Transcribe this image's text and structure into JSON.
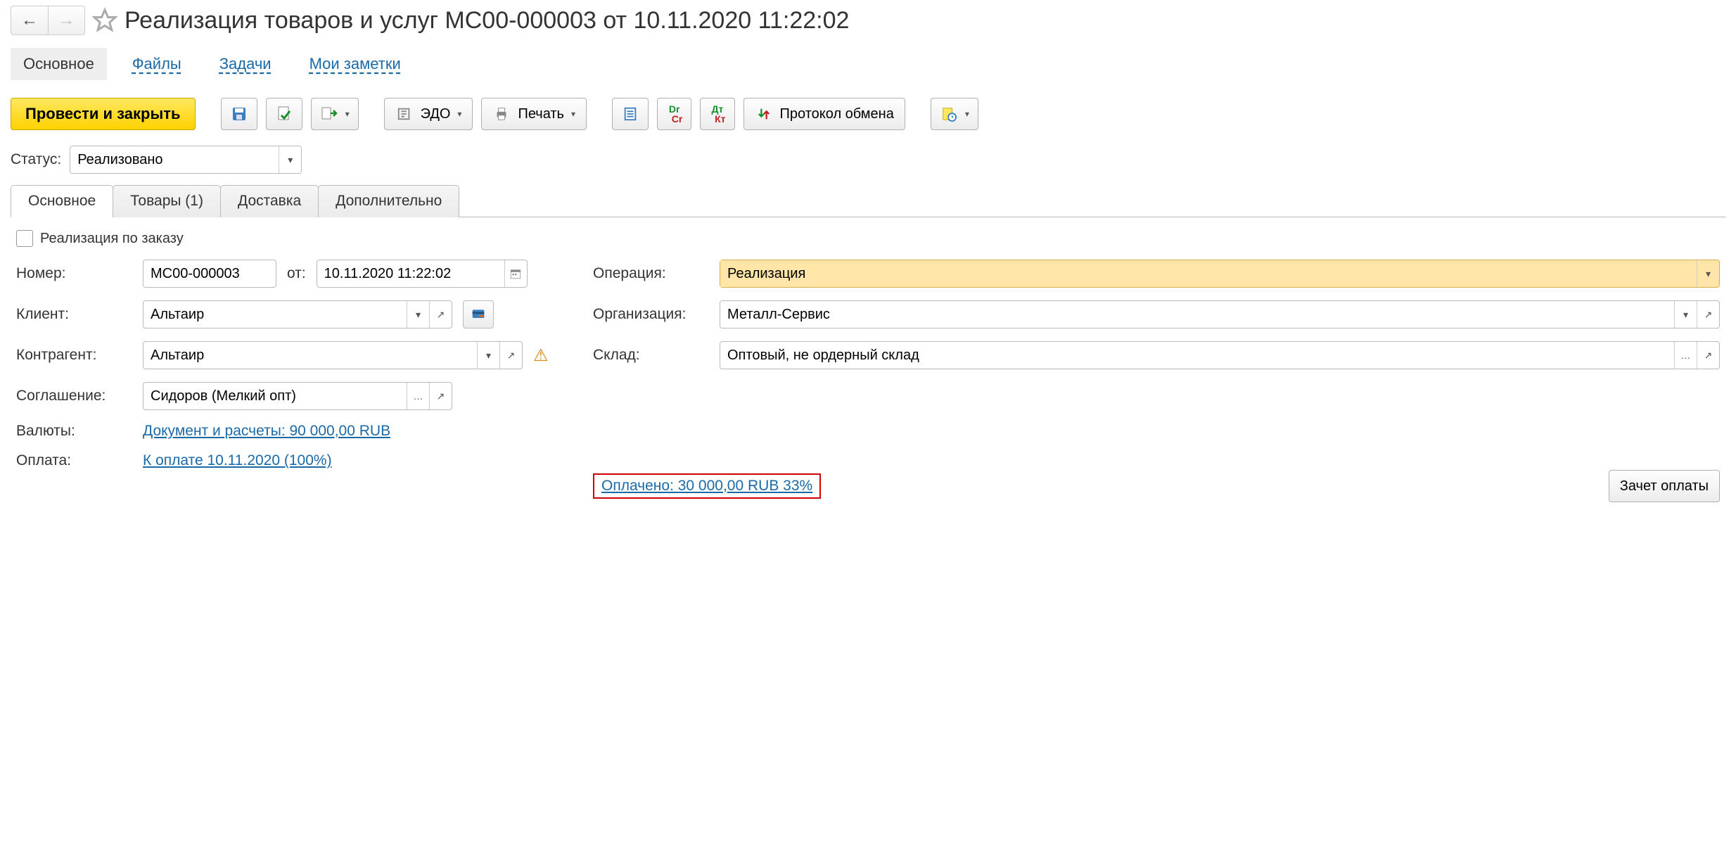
{
  "title": "Реализация товаров и услуг МС00-000003 от 10.11.2020 11:22:02",
  "navTabs": {
    "main": "Основное",
    "files": "Файлы",
    "tasks": "Задачи",
    "notes": "Мои заметки"
  },
  "toolbar": {
    "submit_close": "Провести и закрыть",
    "edo": "ЭДО",
    "print": "Печать",
    "protocol": "Протокол обмена"
  },
  "status": {
    "label": "Статус:",
    "value": "Реализовано"
  },
  "subTabs": {
    "main": "Основное",
    "goods": "Товары (1)",
    "delivery": "Доставка",
    "extra": "Дополнительно"
  },
  "form": {
    "order_checkbox": "Реализация по заказу",
    "number_label": "Номер:",
    "number_value": "МС00-000003",
    "date_label": "от:",
    "date_value": "10.11.2020 11:22:02",
    "client_label": "Клиент:",
    "client_value": "Альтаир",
    "counterparty_label": "Контрагент:",
    "counterparty_value": "Альтаир",
    "agreement_label": "Соглашение:",
    "agreement_value": "Сидоров (Мелкий опт)",
    "currency_label": "Валюты:",
    "currency_link": "Документ и расчеты: 90 000,00 RUB",
    "payment_label": "Оплата:",
    "payment_link": "К оплате 10.11.2020 (100%)",
    "paid_text": "Оплачено: 30 000,00 RUB  33%",
    "pay_offset_btn": "Зачет оплаты",
    "operation_label": "Операция:",
    "operation_value": "Реализация",
    "org_label": "Организация:",
    "org_value": "Металл-Сервис",
    "warehouse_label": "Склад:",
    "warehouse_value": "Оптовый, не ордерный склад"
  }
}
